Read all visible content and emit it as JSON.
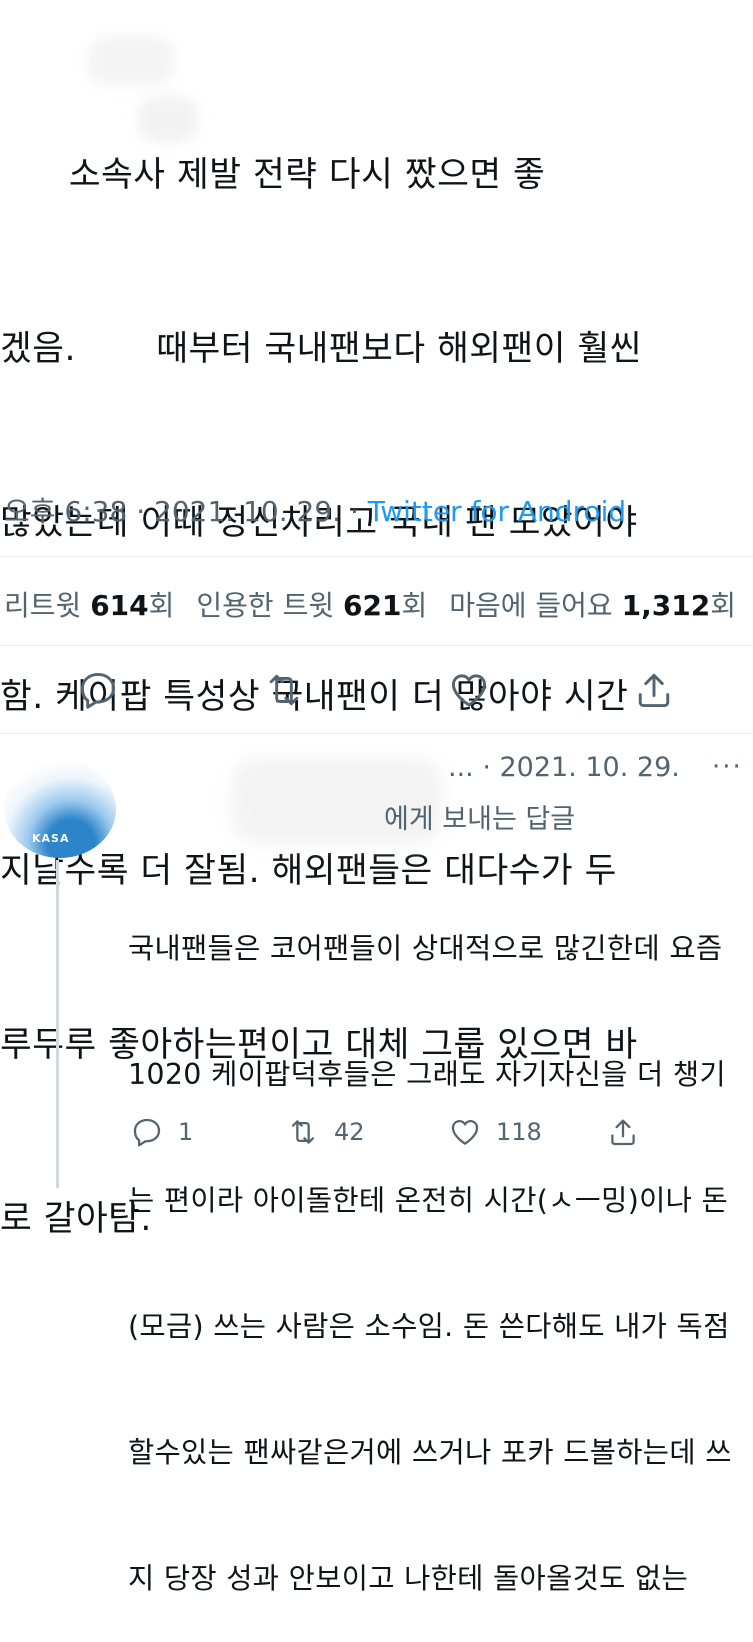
{
  "tweet": {
    "lines": [
      "      소속사 제발 전략 다시 짰으면 좋",
      "겠음.       때부터 국내팬보다 해외팬이 훨씬",
      "많았는데 이때 정신차리고 국내 팬 모았어야",
      "함. 케이팝 특성상 국내팬이 더 많아야 시간",
      "지날수록 더 잘됨. 해외팬들은 대다수가 두",
      "루두루 좋아하는편이고 대체 그룹 있으면 바",
      "로 갈아탐."
    ],
    "time": "오후 6:38",
    "date": "2021. 10. 29.",
    "source": "Twitter for Android",
    "separator": " · "
  },
  "stats": {
    "retweet_label": "리트윗 ",
    "retweet_count": "614",
    "retweet_suffix": "회",
    "quote_label": "인용한 트윗 ",
    "quote_count": "621",
    "quote_suffix": "회",
    "like_label": "마음에 들어요 ",
    "like_count": "1,312",
    "like_suffix": "회"
  },
  "actions": {
    "reply": "reply-icon",
    "retweet": "retweet-icon",
    "like": "heart-icon",
    "share": "share-icon"
  },
  "reply": {
    "header_date": "... · 2021. 10. 29.",
    "more": "···",
    "replying_to": "에게 보내는 답글",
    "avatar_text": "KASA",
    "lines": [
      "국내팬들은 코어팬들이 상대적으로 많긴한데 요즘",
      "1020 케이팝덕후들은 그래도 자기자신을 더 챙기",
      "는 편이라 아이돌한테 온전히 시간(ㅅㅡ밍)이나 돈",
      "(모금) 쓰는 사람은 소수임. 돈 쓴다해도 내가 독점",
      "할수있는 팬싸같은거에 쓰거나 포카 드볼하는데 쓰",
      "지 당장 성과 안보이고 나한테 돌아올것도 없는"
    ],
    "reply_count": "1",
    "retweet_count": "42",
    "like_count": "118"
  },
  "colors": {
    "text": "#0f1419",
    "secondary": "#536471",
    "link": "#1d9bf0",
    "divider": "#e6ecf0"
  }
}
